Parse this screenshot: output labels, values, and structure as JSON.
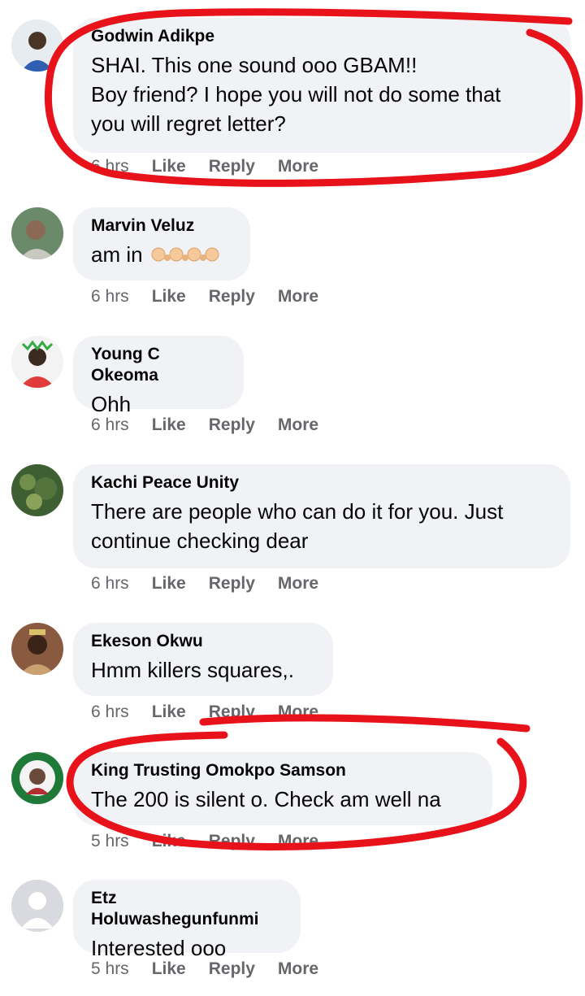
{
  "comments": [
    {
      "author": "Godwin Adikpe",
      "lines": [
        "SHAI. This one sound ooo GBAM!!",
        "Boy friend? I hope you will not do some that",
        "you will regret letter?"
      ],
      "time": "6 hrs"
    },
    {
      "author": "Marvin Veluz",
      "lines": [
        "am in"
      ],
      "time": "6 hrs"
    },
    {
      "author": "Young C Okeoma",
      "lines": [
        "Ohh"
      ],
      "time": "6 hrs"
    },
    {
      "author": "Kachi Peace Unity",
      "lines": [
        "There are people who can do it for you. Just",
        "continue checking dear"
      ],
      "time": "6 hrs"
    },
    {
      "author": "Ekeson Okwu",
      "lines": [
        "Hmm killers squares,."
      ],
      "time": "6 hrs"
    },
    {
      "author": "King Trusting Omokpo Samson",
      "lines": [
        "The 200 is silent o. Check am well na"
      ],
      "time": "5 hrs"
    },
    {
      "author": "Etz Holuwashegunfunmi",
      "lines": [
        "Interested ooo"
      ],
      "time": "5 hrs"
    }
  ],
  "actions": {
    "like": "Like",
    "reply": "Reply",
    "more": "More"
  },
  "colors": {
    "bubble": "#f0f2f5",
    "meta": "#65676b",
    "annotation": "#e8121a"
  },
  "icons": {
    "reaction_emoji": "raising-hands-emoji"
  }
}
